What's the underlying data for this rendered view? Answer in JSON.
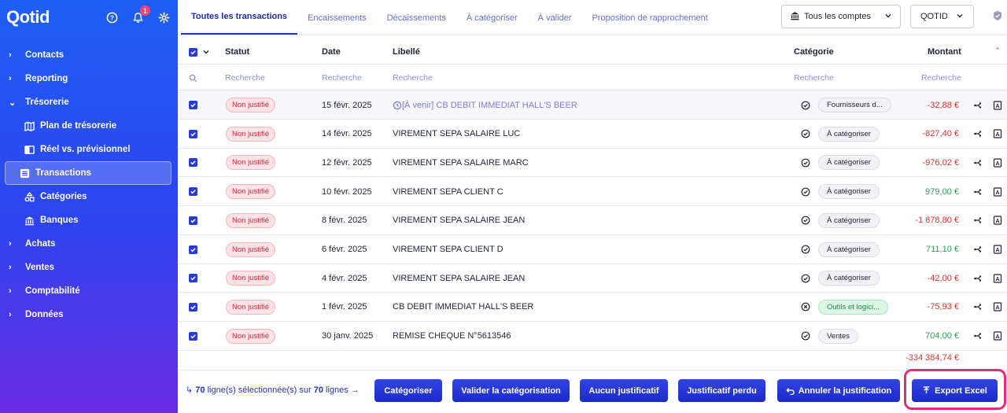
{
  "sidebar": {
    "logo": "Qotid",
    "notification_count": "1",
    "items": [
      {
        "label": "Contacts"
      },
      {
        "label": "Reporting"
      },
      {
        "label": "Trésorerie"
      },
      {
        "label": "Plan de trésorerie"
      },
      {
        "label": "Réel vs. prévisionnel"
      },
      {
        "label": "Transactions"
      },
      {
        "label": "Catégories"
      },
      {
        "label": "Banques"
      },
      {
        "label": "Achats"
      },
      {
        "label": "Ventes"
      },
      {
        "label": "Comptabilité"
      },
      {
        "label": "Données"
      }
    ]
  },
  "tabs": [
    "Toutes les transactions",
    "Encaissements",
    "Décaissements",
    "À catégoriser",
    "À valider",
    "Proposition de rapprochement"
  ],
  "account_select": "Tous les comptes",
  "org_select": "QOTID",
  "table": {
    "headers": {
      "status": "Statut",
      "date": "Date",
      "label": "Libellé",
      "category": "Catégorie",
      "amount": "Montant"
    },
    "search_placeholder": "Recherche",
    "rows": [
      {
        "status": "Non justifié",
        "date": "15 févr. 2025",
        "label": "[À venir] CB DEBIT IMMEDIAT HALL'S BEER",
        "category": "Fournisseurs d...",
        "amount": "-32,88 €"
      },
      {
        "status": "Non justifié",
        "date": "14 févr. 2025",
        "label": "VIREMENT SEPA SALAIRE LUC",
        "category": "À catégoriser",
        "amount": "-827,40 €"
      },
      {
        "status": "Non justifié",
        "date": "12 févr. 2025",
        "label": "VIREMENT SEPA SALAIRE MARC",
        "category": "À catégoriser",
        "amount": "-976,02 €"
      },
      {
        "status": "Non justifié",
        "date": "10 févr. 2025",
        "label": "VIREMENT SEPA CLIENT C",
        "category": "À catégoriser",
        "amount": "979,00 €"
      },
      {
        "status": "Non justifié",
        "date": "8 févr. 2025",
        "label": "VIREMENT SEPA SALAIRE JEAN",
        "category": "À catégoriser",
        "amount": "-1 678,80 €"
      },
      {
        "status": "Non justifié",
        "date": "6 févr. 2025",
        "label": "VIREMENT SEPA CLIENT D",
        "category": "À catégoriser",
        "amount": "711,10 €"
      },
      {
        "status": "Non justifié",
        "date": "4 févr. 2025",
        "label": "VIREMENT SEPA SALAIRE JEAN",
        "category": "À catégoriser",
        "amount": "-42,00 €"
      },
      {
        "status": "Non justifié",
        "date": "1 févr. 2025",
        "label": "CB DEBIT IMMEDIAT HALL'S BEER",
        "category": "Outils et logici...",
        "amount": "-75,93 €"
      },
      {
        "status": "Non justifié",
        "date": "30 janv. 2025",
        "label": "REMISE CHEQUE N°5613546",
        "category": "Ventes",
        "amount": "704,00 €"
      }
    ],
    "total": "-334 384,74 €"
  },
  "footer": {
    "selected_count": "70",
    "selected_mid": " ligne(s) sélectionnée(s) sur ",
    "total_count": "70",
    "selected_suffix": " lignes",
    "buttons": {
      "categorize": "Catégoriser",
      "validate": "Valider la catégorisation",
      "no_proof": "Aucun justificatif",
      "lost_proof": "Justificatif perdu",
      "cancel": "Annuler la justification",
      "export": "Export Excel"
    }
  }
}
